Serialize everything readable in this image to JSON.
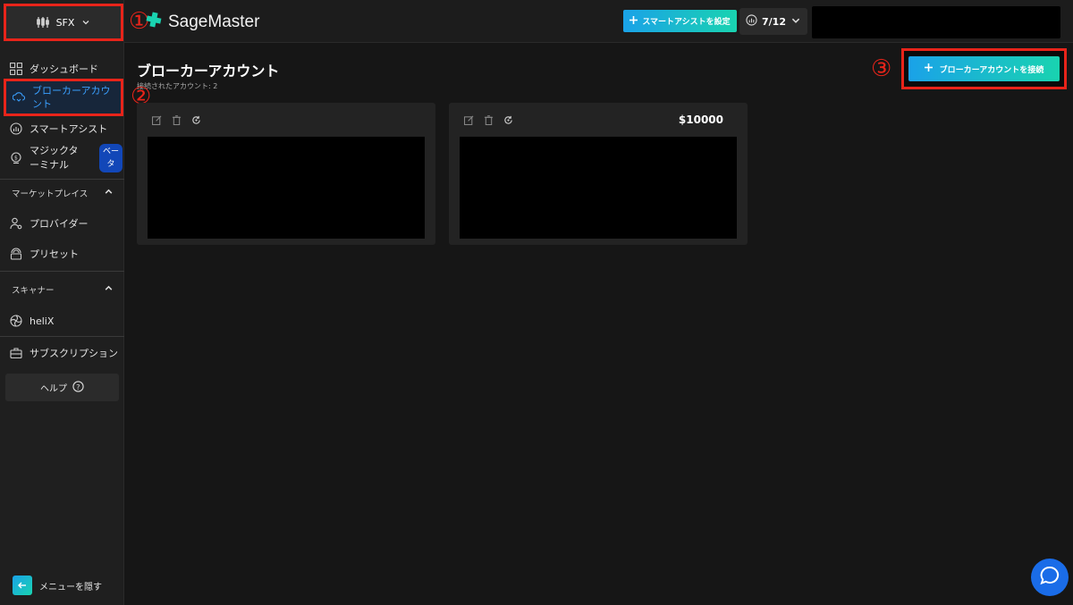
{
  "annotations": {
    "one": "①",
    "two": "②",
    "three": "③"
  },
  "account_switcher": {
    "label": "SFX"
  },
  "brand": {
    "name": "SageMaster"
  },
  "sidebar": {
    "dashboard": "ダッシュボード",
    "broker_accounts": "ブローカーアカウント",
    "smart_assist": "スマートアシスト",
    "magic_terminal": "マジックターミナル",
    "beta": "ベータ",
    "marketplace": "マーケットプレイス",
    "providers": "プロバイダー",
    "presets": "プリセット",
    "scanner": "スキャナー",
    "helix": "heliX",
    "subscription": "サブスクリプション",
    "help": "ヘルプ",
    "hide_menu": "メニューを隠す"
  },
  "header": {
    "smart_assist_button": "スマートアシストを設定",
    "counter": "7/12"
  },
  "main": {
    "title": "ブローカーアカウント",
    "subtitle": "接続されたアカウント: 2",
    "connect_button": "ブローカーアカウントを接続",
    "cards": [
      {
        "balance": ""
      },
      {
        "balance": "$10000"
      }
    ]
  },
  "colors": {
    "background": "#161616",
    "sidebar": "#1f1f1f",
    "accent_gradient_start": "#1aa2e8",
    "accent_gradient_end": "#19d3b0",
    "annotation_red": "#e8241a",
    "active_text": "#3aa0ff"
  },
  "icons": [
    "candlestick-icon",
    "chevron-down-icon",
    "grid-icon",
    "cloud-sync-icon",
    "chart-icon",
    "coin-icon",
    "chevron-up-icon",
    "user-gear-icon",
    "preset-icon",
    "helix-icon",
    "briefcase-icon",
    "question-icon",
    "arrow-left-icon",
    "plus-icon",
    "edit-icon",
    "trash-icon",
    "refresh-icon",
    "chat-icon"
  ]
}
